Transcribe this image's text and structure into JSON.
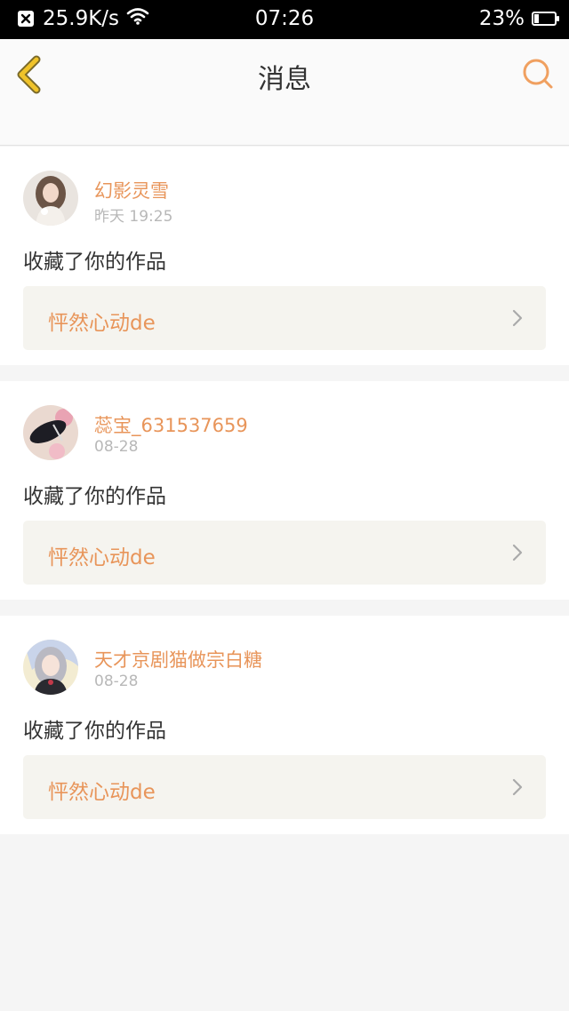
{
  "status_bar": {
    "speed": "25.9K/s",
    "time": "07:26",
    "battery_percent": "23%",
    "battery_level": 0.23,
    "icons": [
      "close-box-icon",
      "wifi-icon",
      "battery-icon"
    ]
  },
  "nav": {
    "title": "消息",
    "back_icon": "chevron-left-icon",
    "search_icon": "search-icon"
  },
  "colors": {
    "accent": "#e8955a",
    "back_arrow": "#f0c32a",
    "background": "#f5f5f5",
    "card": "#ffffff",
    "work_box": "#f5f4ef"
  },
  "notifications": [
    {
      "username": "幻影灵雪",
      "date": "昨天 19:25",
      "action": "收藏了你的作品",
      "work_title": "怦然心动de"
    },
    {
      "username": "蕊宝_631537659",
      "date": "08-28",
      "action": "收藏了你的作品",
      "work_title": "怦然心动de"
    },
    {
      "username": "天才京剧猫做宗白糖",
      "date": "08-28",
      "action": "收藏了你的作品",
      "work_title": "怦然心动de"
    }
  ]
}
